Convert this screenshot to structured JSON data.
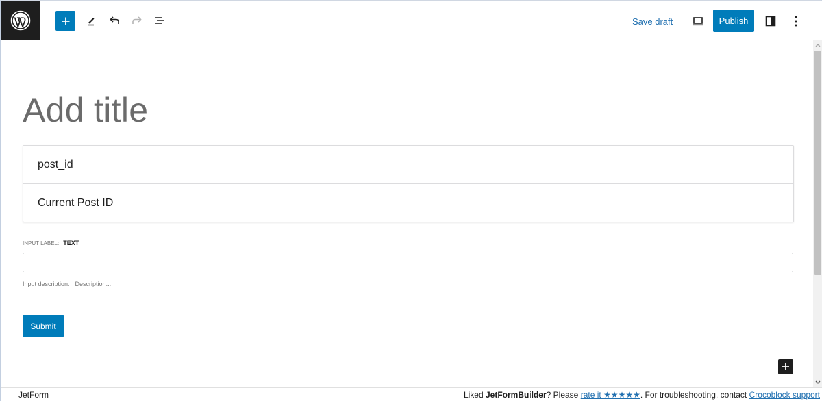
{
  "toolbar": {
    "logo_icon": "wordpress-logo-icon",
    "add_icon": "plus-icon",
    "tools_icon": "pencil-icon",
    "undo_icon": "undo-icon",
    "redo_icon": "redo-icon",
    "list_view_icon": "list-view-icon",
    "save_draft_label": "Save draft",
    "preview_icon": "laptop-icon",
    "publish_label": "Publish",
    "settings_icon": "sidebar-toggle-icon",
    "options_icon": "more-vertical-icon"
  },
  "editor": {
    "title_placeholder": "Add title",
    "hidden_field": {
      "name": "post_id",
      "value": "Current Post ID"
    },
    "text_field": {
      "label_caption": "INPUT LABEL:",
      "label_value": "TEXT",
      "value": "",
      "desc_caption": "Input description:",
      "desc_placeholder": "Description..."
    },
    "submit_label": "Submit",
    "inserter_icon": "plus-icon"
  },
  "footer": {
    "left": "JetForm",
    "liked": "Liked",
    "plugin": "JetFormBuilder",
    "please": "? Please",
    "rate_link": "rate it ★★★★★",
    "troubleshoot": ". For troubleshooting, contact",
    "support_link": "Crocoblock support"
  },
  "colors": {
    "accent": "#007cba",
    "link": "#2271b1",
    "dark": "#1e1e1e"
  }
}
